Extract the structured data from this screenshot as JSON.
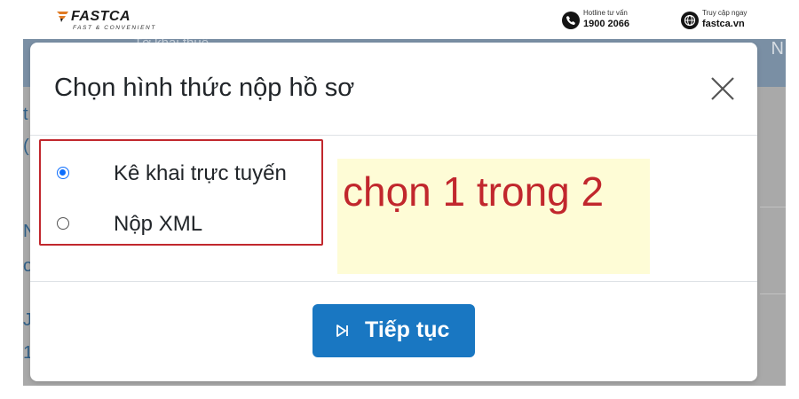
{
  "brand": {
    "name": "FASTCA",
    "tagline": "FAST & CONVENIENT",
    "accent_color": "#e07b24"
  },
  "contact": {
    "hotline_label": "Hotline tư vấn",
    "hotline_number": "1900 2066",
    "hotline_icon": "phone-icon",
    "website_label": "Truy cập ngay",
    "website_url": "fastca.vn",
    "website_icon": "globe-icon"
  },
  "background_page": {
    "header_text": "Tờ khai thuế",
    "header_right": "N",
    "left_letters": [
      "t",
      "(",
      "N",
      "o",
      "J",
      "1"
    ]
  },
  "modal": {
    "title": "Chọn hình thức nộp hồ sơ",
    "close_icon": "close-icon",
    "options": [
      {
        "label": "Kê khai trực tuyến",
        "selected": true
      },
      {
        "label": "Nộp XML",
        "selected": false
      }
    ],
    "annotation": "chọn 1 trong 2",
    "annotation_color": "#c1272d",
    "continue_label": "Tiếp tục",
    "continue_icon": "skip-forward-icon",
    "primary_color": "#1977c2"
  }
}
